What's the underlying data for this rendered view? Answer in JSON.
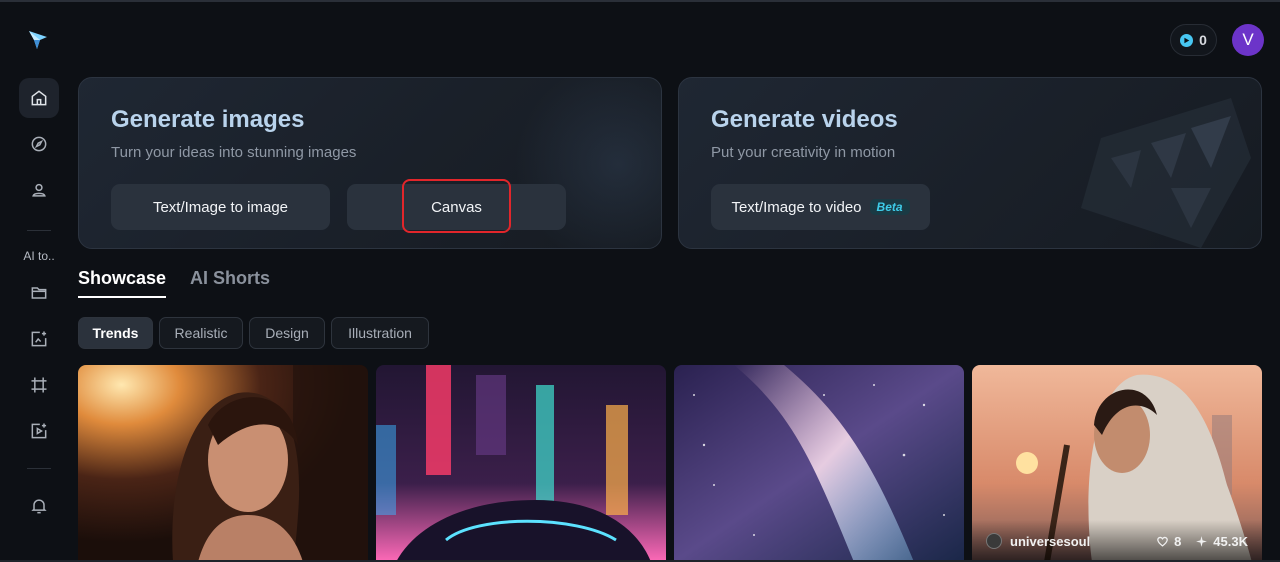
{
  "sidebar": {
    "logo_icon": "sparkle-logo-icon",
    "ai_tools_label": "AI to..",
    "items": [
      {
        "name": "home",
        "icon": "home-icon"
      },
      {
        "name": "explore",
        "icon": "compass-icon"
      },
      {
        "name": "profile",
        "icon": "user-icon"
      },
      {
        "name": "assets",
        "icon": "folder-icon"
      },
      {
        "name": "image-tool",
        "icon": "image-sparkle-icon"
      },
      {
        "name": "canvas-tool",
        "icon": "crop-frame-icon"
      },
      {
        "name": "video-tool",
        "icon": "video-sparkle-icon"
      },
      {
        "name": "notifications",
        "icon": "bell-icon"
      }
    ]
  },
  "header": {
    "credits": "0",
    "avatar_initial": "V",
    "avatar_color": "#6c34c9"
  },
  "cards": {
    "images": {
      "title": "Generate images",
      "subtitle": "Turn your ideas into stunning images",
      "btn_text_image": "Text/Image to image",
      "btn_canvas": "Canvas"
    },
    "videos": {
      "title": "Generate videos",
      "subtitle": "Put your creativity in motion",
      "btn_text_video": "Text/Image to video",
      "beta": "Beta"
    }
  },
  "tabs": [
    {
      "label": "Showcase",
      "active": true
    },
    {
      "label": "AI Shorts",
      "active": false
    }
  ],
  "filters": [
    {
      "label": "Trends",
      "active": true
    },
    {
      "label": "Realistic",
      "active": false
    },
    {
      "label": "Design",
      "active": false
    },
    {
      "label": "Illustration",
      "active": false
    }
  ],
  "gallery": [
    {
      "subject": "portrait-woman-sunset"
    },
    {
      "subject": "sports-car-neon-city"
    },
    {
      "subject": "galaxy-milky-way"
    },
    {
      "subject": "woman-veil-instrument",
      "author": "universesoul",
      "likes": "8",
      "remixes": "45.3K"
    }
  ],
  "colors": {
    "accent": "#48c7f2",
    "highlight": "#e2262b",
    "title": "#b9d3ec"
  }
}
